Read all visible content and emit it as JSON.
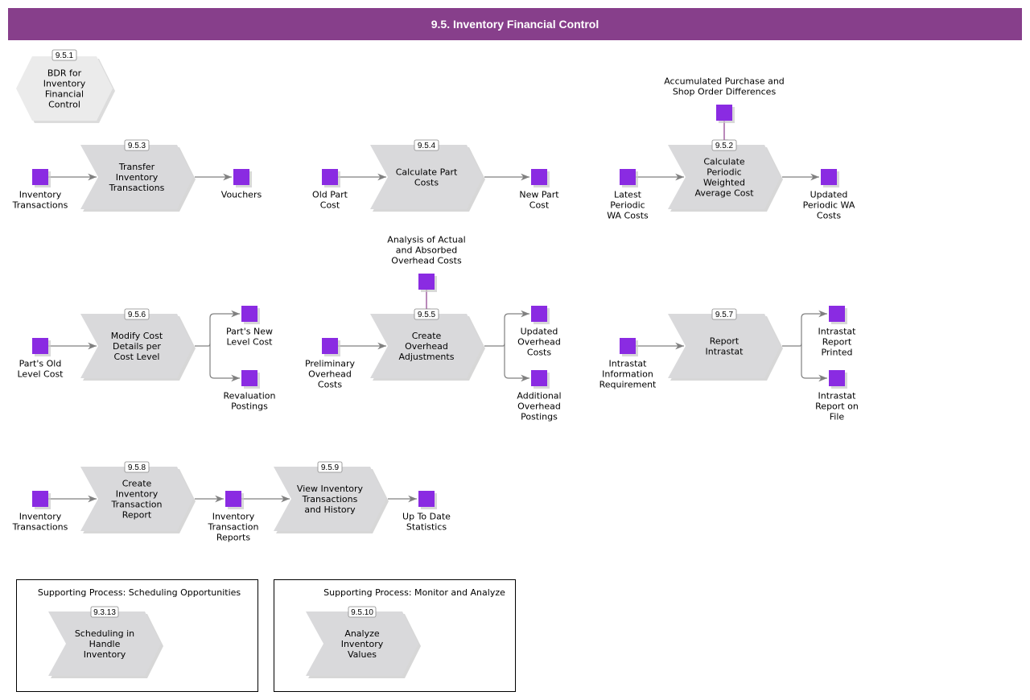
{
  "header": {
    "title": "9.5. Inventory Financial Control"
  },
  "colors": {
    "header_bg": "#873f8b",
    "process_fill": "#d9d9db",
    "hexagon_fill": "#ebebeb",
    "information_object": "#8a2be2",
    "connector": "#808080",
    "control_connector": "#8b3a8b"
  },
  "bdr": {
    "id": "9.5.1",
    "label": [
      "BDR for",
      "Inventory",
      "Financial",
      "Control"
    ]
  },
  "processes": [
    {
      "key": "p953",
      "id": "9.5.3",
      "label": [
        "Transfer",
        "Inventory",
        "Transactions"
      ]
    },
    {
      "key": "p954",
      "id": "9.5.4",
      "label": [
        "Calculate Part",
        "Costs"
      ]
    },
    {
      "key": "p952",
      "id": "9.5.2",
      "label": [
        "Calculate",
        "Periodic",
        "Weighted",
        "Average Cost"
      ]
    },
    {
      "key": "p956",
      "id": "9.5.6",
      "label": [
        "Modify Cost",
        "Details per",
        "Cost Level"
      ]
    },
    {
      "key": "p955",
      "id": "9.5.5",
      "label": [
        "Create",
        "Overhead",
        "Adjustments"
      ]
    },
    {
      "key": "p957",
      "id": "9.5.7",
      "label": [
        "Report",
        "Intrastat"
      ]
    },
    {
      "key": "p958",
      "id": "9.5.8",
      "label": [
        "Create",
        "Inventory",
        "Transaction",
        "Report"
      ]
    },
    {
      "key": "p959",
      "id": "9.5.9",
      "label": [
        "View Inventory",
        "Transactions",
        "and History"
      ]
    }
  ],
  "information_objects": [
    {
      "key": "i1",
      "label": [
        "Inventory",
        "Transactions"
      ]
    },
    {
      "key": "i2",
      "label": [
        "Vouchers"
      ]
    },
    {
      "key": "i3",
      "label": [
        "Old Part",
        "Cost"
      ]
    },
    {
      "key": "i4",
      "label": [
        "New Part",
        "Cost"
      ]
    },
    {
      "key": "i5",
      "label": [
        "Accumulated Purchase and",
        "Shop Order Differences"
      ]
    },
    {
      "key": "i6",
      "label": [
        "Latest",
        "Periodic",
        "WA Costs"
      ]
    },
    {
      "key": "i7",
      "label": [
        "Updated",
        "Periodic WA",
        "Costs"
      ]
    },
    {
      "key": "i8",
      "label": [
        "Part's Old",
        "Level Cost"
      ]
    },
    {
      "key": "i9",
      "label": [
        "Part's New",
        "Level Cost"
      ]
    },
    {
      "key": "i10",
      "label": [
        "Revaluation",
        "Postings"
      ]
    },
    {
      "key": "i11",
      "label": [
        "Analysis of Actual",
        "and Absorbed",
        "Overhead Costs"
      ]
    },
    {
      "key": "i12",
      "label": [
        "Preliminary",
        "Overhead",
        "Costs"
      ]
    },
    {
      "key": "i13",
      "label": [
        "Updated",
        "Overhead",
        "Costs"
      ]
    },
    {
      "key": "i14",
      "label": [
        "Additional",
        "Overhead",
        "Postings"
      ]
    },
    {
      "key": "i15",
      "label": [
        "Intrastat",
        "Information",
        "Requirement"
      ]
    },
    {
      "key": "i16",
      "label": [
        "Intrastat",
        "Report",
        "Printed"
      ]
    },
    {
      "key": "i17",
      "label": [
        "Intrastat",
        "Report on",
        "File"
      ]
    },
    {
      "key": "i18",
      "label": [
        "Inventory",
        "Transactions"
      ]
    },
    {
      "key": "i19",
      "label": [
        "Inventory",
        "Transaction",
        "Reports"
      ]
    },
    {
      "key": "i20",
      "label": [
        "Up To Date",
        "Statistics"
      ]
    }
  ],
  "supporting_processes": [
    {
      "key": "s1",
      "title": "Supporting Process: Scheduling Opportunities",
      "process": {
        "id": "9.3.13",
        "label": [
          "Scheduling in",
          "Handle",
          "Inventory"
        ]
      }
    },
    {
      "key": "s2",
      "title": "Supporting Process: Monitor and Analyze",
      "process": {
        "id": "9.5.10",
        "label": [
          "Analyze",
          "Inventory",
          "Values"
        ]
      }
    }
  ]
}
